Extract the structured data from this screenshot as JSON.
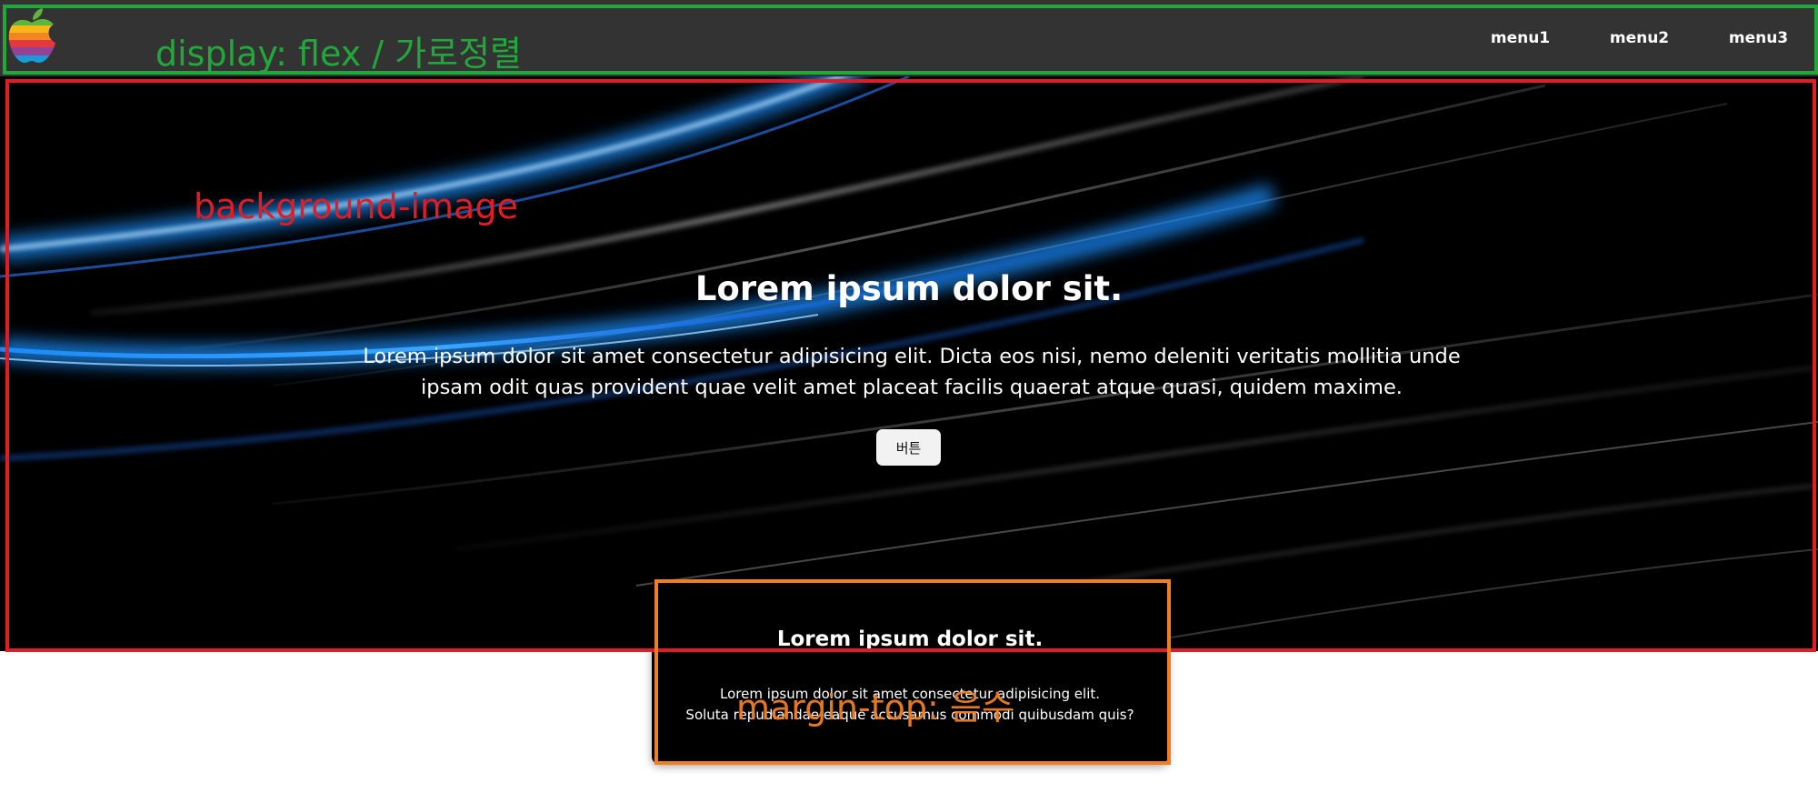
{
  "colors": {
    "navbar_bg": "#333333",
    "annotation_green": "#22a83a",
    "annotation_red": "#e31b23",
    "annotation_orange": "#f07f22",
    "hero_bg": "#000000",
    "accent_blue": "#1e90ff"
  },
  "header": {
    "logo_icon": "apple-logo-icon",
    "menu": [
      {
        "label": "menu1"
      },
      {
        "label": "menu2"
      },
      {
        "label": "menu3"
      }
    ]
  },
  "hero": {
    "title": "Lorem ipsum dolor sit.",
    "text": "Lorem ipsum dolor sit amet consectetur adipisicing elit. Dicta eos nisi, nemo deleniti veritatis mollitia unde ipsam odit quas provident quae velit amet placeat facilis quaerat atque quasi, quidem maxime.",
    "button_label": "버튼"
  },
  "card": {
    "title": "Lorem ipsum dolor sit.",
    "text_line1": "Lorem ipsum dolor sit amet consectetur adipisicing elit.",
    "text_line2": "Soluta repudiandae eaque accusamus commodi quibusdam quis?"
  },
  "annotations": {
    "header_note": "display: flex / 가로정렬",
    "hero_note": "background-image",
    "card_note": "margin-top: 음수"
  }
}
